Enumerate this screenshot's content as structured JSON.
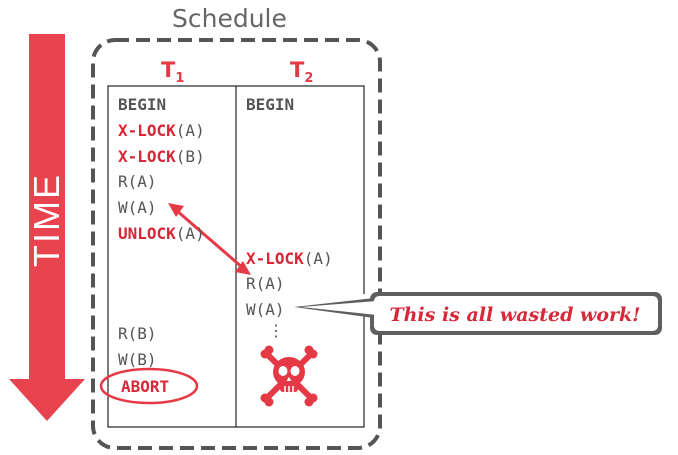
{
  "diagram": {
    "time_label": "TIME",
    "schedule_label": "Schedule",
    "t1_header": "T",
    "t1_sub": "1",
    "t2_header": "T",
    "t2_sub": "2",
    "t1_ops": {
      "begin": "BEGIN",
      "xlock_a_kw": "X-LOCK",
      "xlock_a_arg": "(A)",
      "xlock_b_kw": "X-LOCK",
      "xlock_b_arg": "(B)",
      "read_a": "R(A)",
      "write_a": "W(A)",
      "unlock_a_kw": "UNLOCK",
      "unlock_a_arg": "(A)",
      "read_b": "R(B)",
      "write_b": "W(B)",
      "abort": "ABORT"
    },
    "t2_ops": {
      "begin": "BEGIN",
      "xlock_a_kw": "X-LOCK",
      "xlock_a_arg": "(A)",
      "read_a": "R(A)",
      "write_a": "W(A)",
      "continuation": "⋮"
    },
    "callout": "This is all wasted work!",
    "colors": {
      "accent_red": "#e63946",
      "text_gray": "#555555",
      "dashed_border": "#555555"
    },
    "icons": [
      "time-arrow-icon",
      "skull-crossbones-icon",
      "dependency-arrow-icon"
    ]
  }
}
